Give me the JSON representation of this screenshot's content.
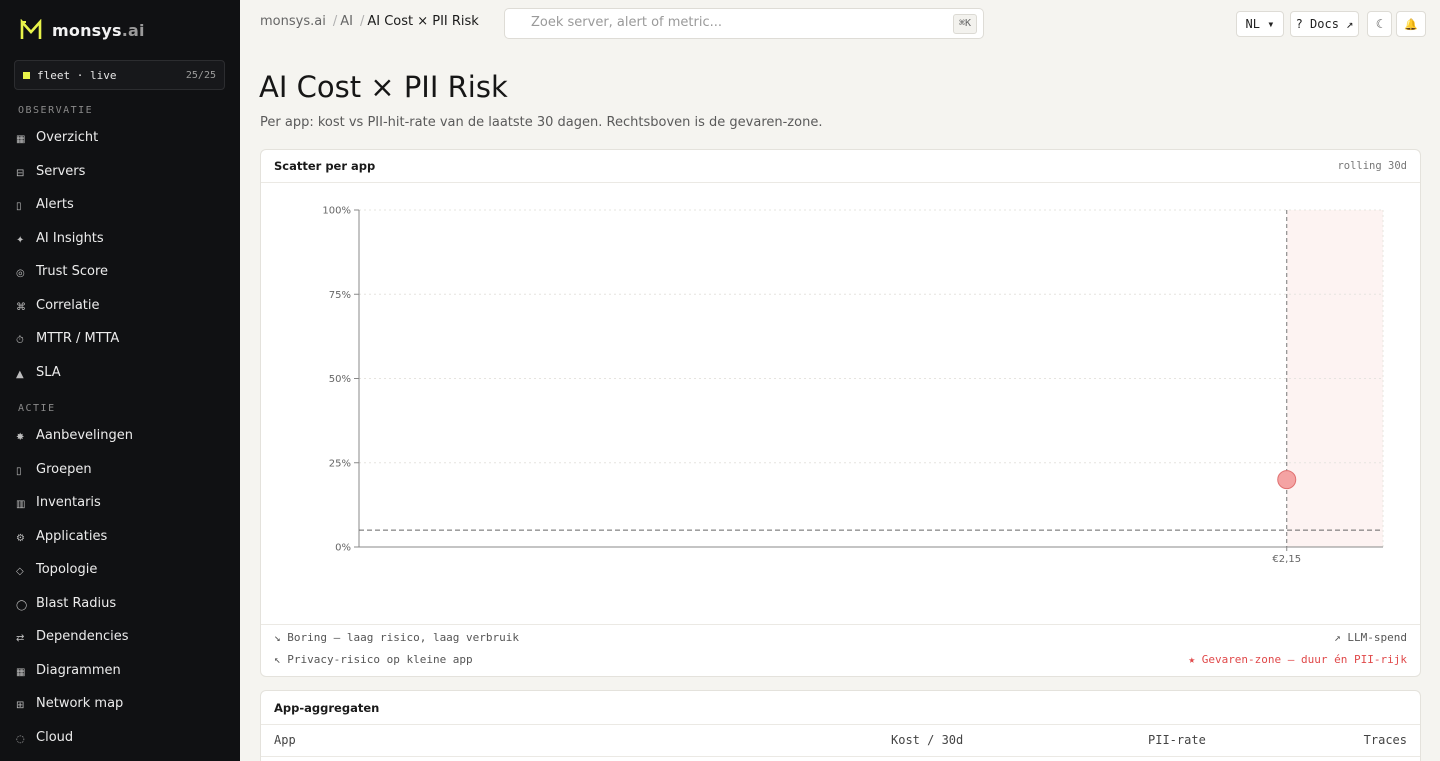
{
  "brand": {
    "name": "monsys",
    "tld": ".ai"
  },
  "fleet": {
    "label": "fleet · live",
    "count": "25/25"
  },
  "sidebar": {
    "sections": [
      {
        "label": "OBSERVATIE",
        "items": [
          {
            "label": "Overzicht",
            "icon": "▦",
            "icon_name": "grid-icon"
          },
          {
            "label": "Servers",
            "icon": "⊟",
            "icon_name": "server-icon"
          },
          {
            "label": "Alerts",
            "icon": "▯",
            "icon_name": "bell-icon"
          },
          {
            "label": "AI Insights",
            "icon": "✦",
            "icon_name": "sparkle-icon"
          },
          {
            "label": "Trust Score",
            "icon": "◎",
            "icon_name": "target-icon"
          },
          {
            "label": "Correlatie",
            "icon": "⌘",
            "icon_name": "correlation-icon"
          },
          {
            "label": "MTTR / MTTA",
            "icon": "⏱",
            "icon_name": "stopwatch-icon"
          },
          {
            "label": "SLA",
            "icon": "▲",
            "icon_name": "triangle-icon"
          }
        ]
      },
      {
        "label": "ACTIE",
        "items": [
          {
            "label": "Aanbevelingen",
            "icon": "✸",
            "icon_name": "star-burst-icon"
          },
          {
            "label": "Groepen",
            "icon": "▯",
            "icon_name": "folder-icon"
          },
          {
            "label": "Inventaris",
            "icon": "▥",
            "icon_name": "inventory-icon"
          },
          {
            "label": "Applicaties",
            "icon": "⚙",
            "icon_name": "gear-icon"
          },
          {
            "label": "Topologie",
            "icon": "◇",
            "icon_name": "diamond-icon"
          },
          {
            "label": "Blast Radius",
            "icon": "◯",
            "icon_name": "circle-icon"
          },
          {
            "label": "Dependencies",
            "icon": "⇄",
            "icon_name": "arrows-icon"
          },
          {
            "label": "Diagrammen",
            "icon": "▦",
            "icon_name": "diagram-icon"
          },
          {
            "label": "Network map",
            "icon": "⊞",
            "icon_name": "network-icon"
          },
          {
            "label": "Cloud",
            "icon": "◌",
            "icon_name": "cloud-icon"
          }
        ]
      }
    ]
  },
  "breadcrumb": {
    "root": "monsys.ai",
    "section": "AI",
    "current": "AI Cost × PII Risk"
  },
  "search": {
    "placeholder": "Zoek server, alert of metric...",
    "shortcut": "⌘K"
  },
  "toolbar": {
    "lang": "NL ▾",
    "docs": "? Docs ↗",
    "theme": "☾",
    "notify": "🔔"
  },
  "page": {
    "title": "AI Cost × PII Risk",
    "subtitle": "Per app: kost vs PII-hit-rate van de laatste 30 dagen. Rechtsboven is de gevaren-zone."
  },
  "scatter_card": {
    "title": "Scatter per app",
    "meta": "rolling 30d"
  },
  "chart_data": {
    "type": "scatter",
    "title": "Scatter per app",
    "ylabel": "",
    "xlabel": "",
    "yticks": [
      "0%",
      "25%",
      "50%",
      "75%",
      "100%"
    ],
    "ylim": [
      0,
      100
    ],
    "x_tick_label": "€2,15",
    "points": [
      {
        "x": 2.15,
        "y": 20
      }
    ],
    "threshold_y": 5,
    "danger_zone": "top-right",
    "grid": true
  },
  "legend": {
    "bottom_left_1": "↘ Boring — laag risico, laag verbruik",
    "bottom_left_2": "↖ Privacy-risico op kleine app",
    "bottom_right_1": "↗ LLM-spend",
    "bottom_right_2": "★ Gevaren-zone — duur én PII-rijk",
    "danger_color": "#e0494a"
  },
  "table_card": {
    "title": "App-aggregaten",
    "columns": [
      "App",
      "Kost / 30d",
      "PII-rate",
      "Traces"
    ]
  }
}
